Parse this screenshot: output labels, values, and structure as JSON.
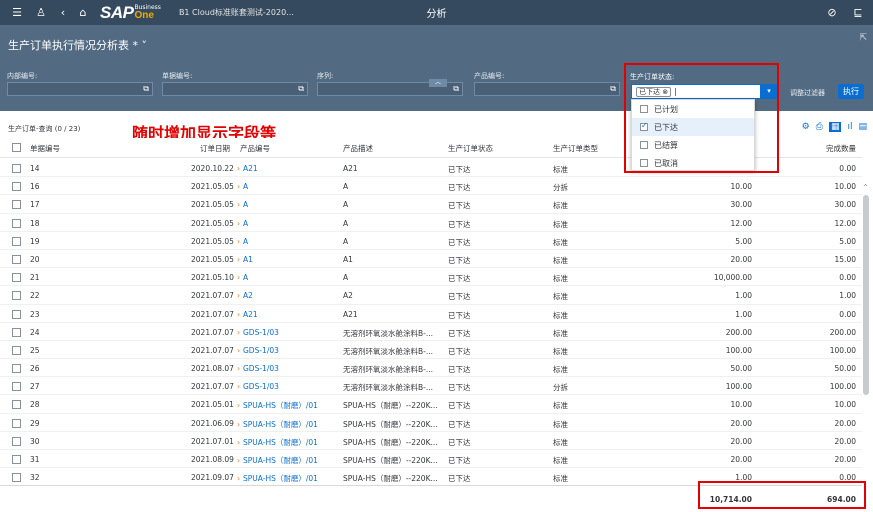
{
  "shell": {
    "sap_text": "SAP",
    "business_text": "Business",
    "one_text": "One",
    "company": "B1 Cloud标准账套测试-2020...",
    "app_title": "分析"
  },
  "header": {
    "page_title": "生产订单执行情况分析表 *",
    "filters": [
      {
        "label": "内部编号:",
        "value": ""
      },
      {
        "label": "单据编号:",
        "value": ""
      },
      {
        "label": "序列:",
        "value": ""
      },
      {
        "label": "产品编号:",
        "value": ""
      }
    ],
    "status_filter": {
      "label": "生产订单状态:",
      "token": "已下达 ⊗",
      "options": [
        {
          "label": "已计划",
          "checked": false
        },
        {
          "label": "已下达",
          "checked": true
        },
        {
          "label": "已结算",
          "checked": false
        },
        {
          "label": "已取消",
          "checked": false
        }
      ]
    },
    "adapt_filters": "调整过滤器",
    "execute": "执行"
  },
  "table": {
    "title": "生产订单-查询 (0 / 23)",
    "annotation": "随时增加显示字段等",
    "columns": [
      "单据编号",
      "订单日期",
      "产品编号",
      "产品描述",
      "生产订单状态",
      "生产订单类型",
      "完成数量"
    ],
    "rows": [
      {
        "no": "14",
        "date": "2020.10.22",
        "product": "A21",
        "desc": "A21",
        "status": "已下达",
        "type": "标准",
        "planned": "",
        "done": "0.00"
      },
      {
        "no": "16",
        "date": "2021.05.05",
        "product": "A",
        "desc": "A",
        "status": "已下达",
        "type": "分拆",
        "planned": "10.00",
        "done": "10.00"
      },
      {
        "no": "17",
        "date": "2021.05.05",
        "product": "A",
        "desc": "A",
        "status": "已下达",
        "type": "标准",
        "planned": "30.00",
        "done": "30.00"
      },
      {
        "no": "18",
        "date": "2021.05.05",
        "product": "A",
        "desc": "A",
        "status": "已下达",
        "type": "标准",
        "planned": "12.00",
        "done": "12.00"
      },
      {
        "no": "19",
        "date": "2021.05.05",
        "product": "A",
        "desc": "A",
        "status": "已下达",
        "type": "标准",
        "planned": "5.00",
        "done": "5.00"
      },
      {
        "no": "20",
        "date": "2021.05.05",
        "product": "A1",
        "desc": "A1",
        "status": "已下达",
        "type": "标准",
        "planned": "20.00",
        "done": "15.00"
      },
      {
        "no": "21",
        "date": "2021.05.10",
        "product": "A",
        "desc": "A",
        "status": "已下达",
        "type": "标准",
        "planned": "10,000.00",
        "done": "0.00"
      },
      {
        "no": "22",
        "date": "2021.07.07",
        "product": "A2",
        "desc": "A2",
        "status": "已下达",
        "type": "标准",
        "planned": "1.00",
        "done": "1.00"
      },
      {
        "no": "23",
        "date": "2021.07.07",
        "product": "A21",
        "desc": "A21",
        "status": "已下达",
        "type": "标准",
        "planned": "1.00",
        "done": "0.00"
      },
      {
        "no": "24",
        "date": "2021.07.07",
        "product": "GDS-1/03",
        "desc": "无溶剂环氧淡水舱涂料B-...",
        "status": "已下达",
        "type": "标准",
        "planned": "200.00",
        "done": "200.00"
      },
      {
        "no": "25",
        "date": "2021.07.07",
        "product": "GDS-1/03",
        "desc": "无溶剂环氧淡水舱涂料B-...",
        "status": "已下达",
        "type": "标准",
        "planned": "100.00",
        "done": "100.00"
      },
      {
        "no": "26",
        "date": "2021.08.07",
        "product": "GDS-1/03",
        "desc": "无溶剂环氧淡水舱涂料B-...",
        "status": "已下达",
        "type": "标准",
        "planned": "50.00",
        "done": "50.00"
      },
      {
        "no": "27",
        "date": "2021.07.07",
        "product": "GDS-1/03",
        "desc": "无溶剂环氧淡水舱涂料B-...",
        "status": "已下达",
        "type": "分拆",
        "planned": "100.00",
        "done": "100.00"
      },
      {
        "no": "28",
        "date": "2021.05.01",
        "product": "SPUA-HS（耐磨）/01",
        "desc": "SPUA-HS（耐磨）--220K...",
        "status": "已下达",
        "type": "标准",
        "planned": "10.00",
        "done": "10.00"
      },
      {
        "no": "29",
        "date": "2021.06.09",
        "product": "SPUA-HS（耐磨）/01",
        "desc": "SPUA-HS（耐磨）--220K...",
        "status": "已下达",
        "type": "标准",
        "planned": "20.00",
        "done": "20.00"
      },
      {
        "no": "30",
        "date": "2021.07.01",
        "product": "SPUA-HS（耐磨）/01",
        "desc": "SPUA-HS（耐磨）--220K...",
        "status": "已下达",
        "type": "标准",
        "planned": "20.00",
        "done": "20.00"
      },
      {
        "no": "31",
        "date": "2021.08.09",
        "product": "SPUA-HS（耐磨）/01",
        "desc": "SPUA-HS（耐磨）--220K...",
        "status": "已下达",
        "type": "标准",
        "planned": "20.00",
        "done": "20.00"
      },
      {
        "no": "32",
        "date": "2021.09.07",
        "product": "SPUA-HS（耐磨）/01",
        "desc": "SPUA-HS（耐磨）--220K...",
        "status": "已下达",
        "type": "标准",
        "planned": "1.00",
        "done": "0.00"
      }
    ],
    "totals": {
      "planned": "10,714.00",
      "done": "694.00"
    }
  },
  "colors": {
    "shell": "#354a5f",
    "header": "#536b82",
    "accent": "#0a6ed1",
    "highlight": "#e30000"
  }
}
